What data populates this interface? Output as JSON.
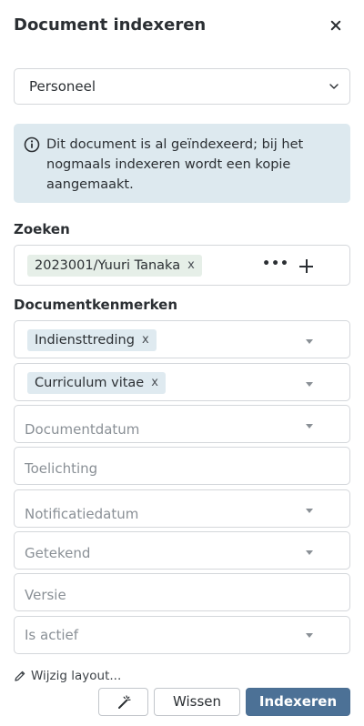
{
  "dialog": {
    "title": "Document indexeren",
    "close_icon": "close-icon"
  },
  "type_select": {
    "value": "Personeel"
  },
  "info": {
    "icon": "info-icon",
    "text": "Dit document is al geïndexeerd; bij het nogmaals indexeren wordt een kopie aangemaakt."
  },
  "search": {
    "label": "Zoeken",
    "chip": "2023001/Yuuri Tanaka",
    "chip_remove": "x",
    "more_label": "•••",
    "add_icon": "plus-icon"
  },
  "properties": {
    "label": "Documentkenmerken",
    "fields": [
      {
        "kind": "select",
        "chip": "Indiensttreding",
        "chip_remove": "x"
      },
      {
        "kind": "select",
        "chip": "Curriculum vitae",
        "chip_remove": "x"
      },
      {
        "kind": "select",
        "placeholder": "Documentdatum"
      },
      {
        "kind": "text",
        "placeholder": "Toelichting"
      },
      {
        "kind": "select",
        "placeholder": "Notificatiedatum"
      },
      {
        "kind": "select",
        "placeholder": "Getekend"
      },
      {
        "kind": "text",
        "placeholder": "Versie"
      },
      {
        "kind": "select",
        "placeholder": "Is actief"
      }
    ]
  },
  "footer": {
    "layout_link": "Wijzig layout...",
    "wand_icon": "magic-wand-icon",
    "clear_label": "Wissen",
    "submit_label": "Indexeren"
  },
  "colors": {
    "primary": "#4c7196",
    "info_bg": "#dde9ef",
    "chip_green": "#e6efe8",
    "chip_blue": "#dfeaf0",
    "border": "#d4d7db"
  }
}
